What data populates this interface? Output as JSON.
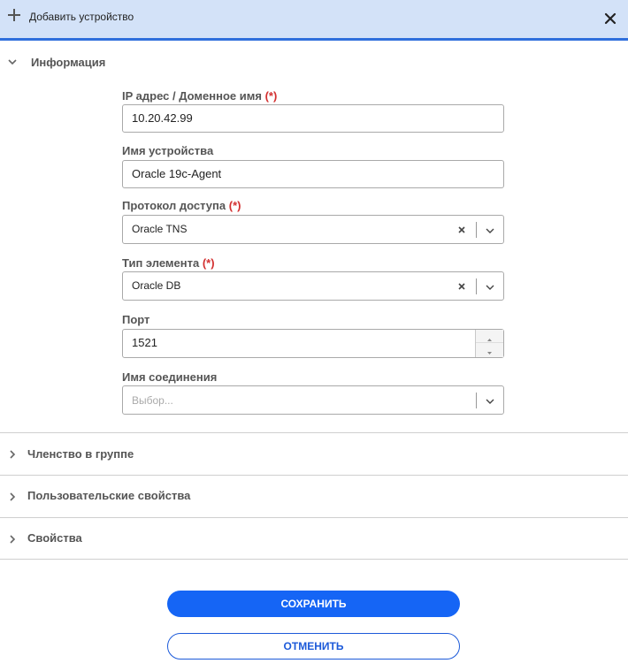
{
  "header": {
    "title": "Добавить устройство"
  },
  "sections": {
    "info": {
      "label": "Информация"
    },
    "group": {
      "label": "Членство в группе"
    },
    "custom": {
      "label": "Пользовательские свойства"
    },
    "props": {
      "label": "Свойства"
    }
  },
  "form": {
    "ip": {
      "label": "IP адрес / Доменное имя",
      "required_mark": "(*)",
      "value": "10.20.42.99"
    },
    "device_name": {
      "label": "Имя устройства",
      "value": "Oracle 19c-Agent"
    },
    "protocol": {
      "label": "Протокол доступа",
      "required_mark": "(*)",
      "value": "Oracle TNS"
    },
    "element_type": {
      "label": "Тип элемента",
      "required_mark": "(*)",
      "value": "Oracle DB"
    },
    "port": {
      "label": "Порт",
      "value": "1521"
    },
    "connection": {
      "label": "Имя соединения",
      "placeholder": "Выбор..."
    }
  },
  "buttons": {
    "save": "СОХРАНИТЬ",
    "cancel": "ОТМЕНИТЬ"
  },
  "colors": {
    "accent": "#1565f5",
    "header_bg": "#d3e2f8",
    "required": "#d32f2f"
  }
}
